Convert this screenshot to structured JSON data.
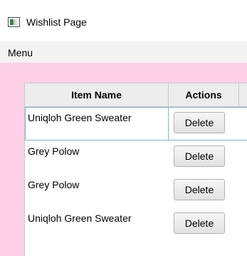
{
  "window": {
    "title": "Wishlist Page"
  },
  "menubar": {
    "menu_label": "Menu"
  },
  "table": {
    "columns": [
      "Item Name",
      "Actions"
    ],
    "rows": [
      {
        "name": "Uniqloh Green Sweater",
        "action_label": "Delete",
        "selected": true
      },
      {
        "name": "Grey Polow",
        "action_label": "Delete",
        "selected": false
      },
      {
        "name": "Grey Polow",
        "action_label": "Delete",
        "selected": false
      },
      {
        "name": "Uniqloh Green Sweater",
        "action_label": "Delete",
        "selected": false
      }
    ]
  },
  "colors": {
    "content_background": "#fdd0e6",
    "header_background": "#ededed",
    "selection_border": "#7fb6d6"
  }
}
